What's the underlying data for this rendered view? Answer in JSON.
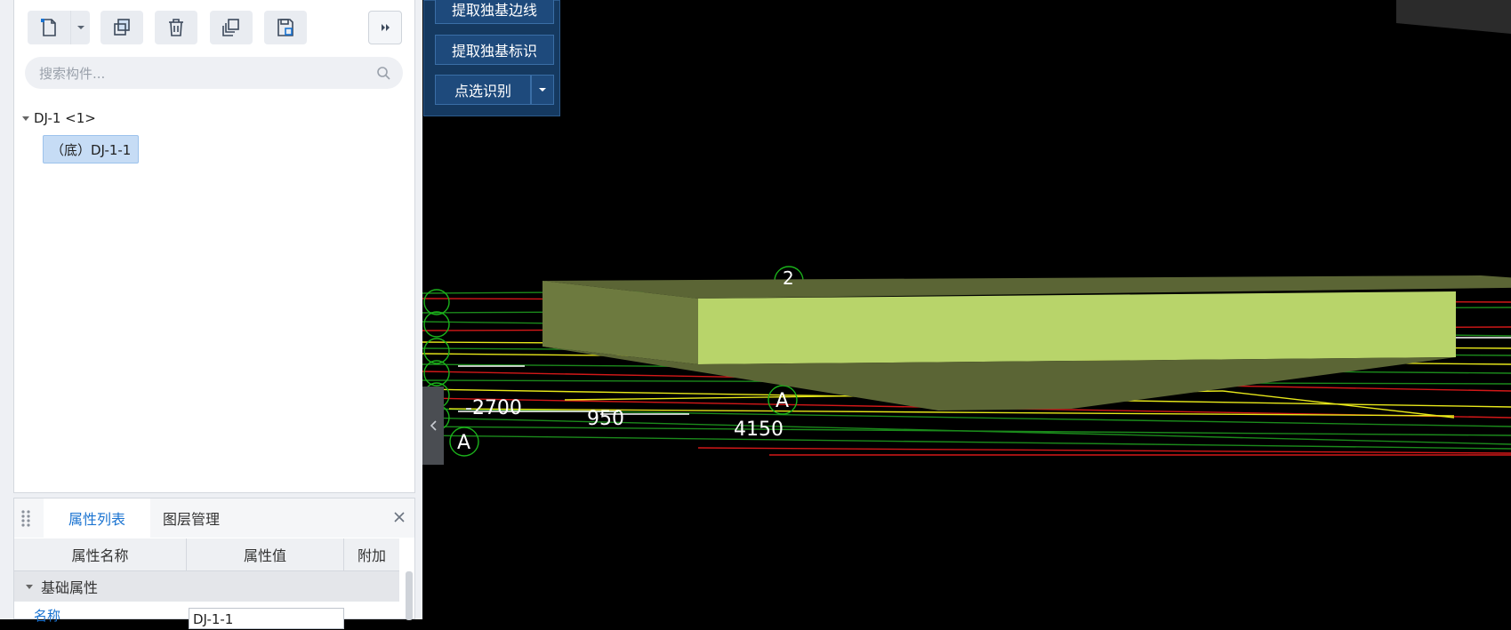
{
  "toolbar": {
    "new_icon": "new-file-icon",
    "copy_icon": "copy-icon",
    "delete_icon": "trash-icon",
    "layer_copy_icon": "layer-copy-icon",
    "save_icon": "save-icon",
    "more_icon": "double-chevron-right-icon"
  },
  "search": {
    "placeholder": "搜索构件..."
  },
  "tree": {
    "root_label": "DJ-1 <1>",
    "child_label": "（底）DJ-1-1"
  },
  "properties": {
    "tabs": [
      "属性列表",
      "图层管理"
    ],
    "columns": [
      "属性名称",
      "属性值",
      "附加"
    ],
    "group": "基础属性",
    "row_name": "名称",
    "row_value": "DJ-1-1"
  },
  "tools": {
    "extract_edge": "提取独基边线",
    "extract_mark": "提取独基标识",
    "pick_identify": "点选识别"
  },
  "cad_labels": {
    "dim_2700": "-2700",
    "dim_950": "950",
    "dim_4150": "4150",
    "axis_a_left": "A",
    "axis_a_center": "A",
    "axis_2": "2"
  },
  "colors": {
    "accent": "#1a73d1",
    "tool_panel": "#153960",
    "slab_top": "#b8d46a",
    "slab_side": "#6d7a3f"
  }
}
